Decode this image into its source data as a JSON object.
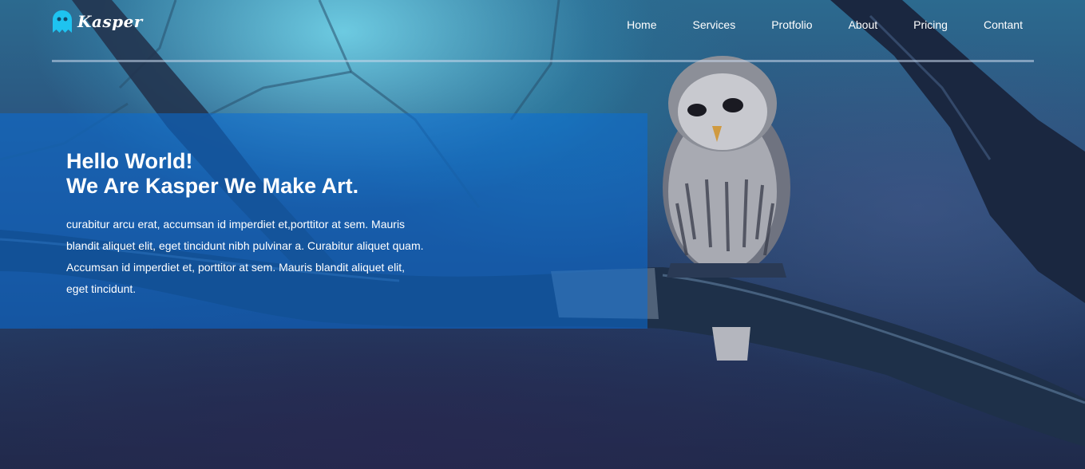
{
  "brand": {
    "name": "Kasper",
    "icon": "ghost-icon",
    "accent": "#1ec3f0"
  },
  "nav": {
    "items": [
      {
        "label": "Home"
      },
      {
        "label": "Services"
      },
      {
        "label": "Protfolio"
      },
      {
        "label": "About"
      },
      {
        "label": "Pricing"
      },
      {
        "label": "Contant"
      }
    ]
  },
  "hero": {
    "title_line1": "Hello World!",
    "title_line2": "We Are Kasper We Make Art.",
    "body": "curabitur arcu erat, accumsan id imperdiet et,porttitor at sem. Mauris blandit aliquet elit, eget tincidunt nibh pulvinar a. Curabitur aliquet quam. Accumsan id imperdiet et, porttitor at sem. Mauris blandit aliquet elit, eget tincidunt.",
    "panel_color": "#0a6ed7"
  },
  "background": {
    "subject": "owl-on-branch"
  }
}
